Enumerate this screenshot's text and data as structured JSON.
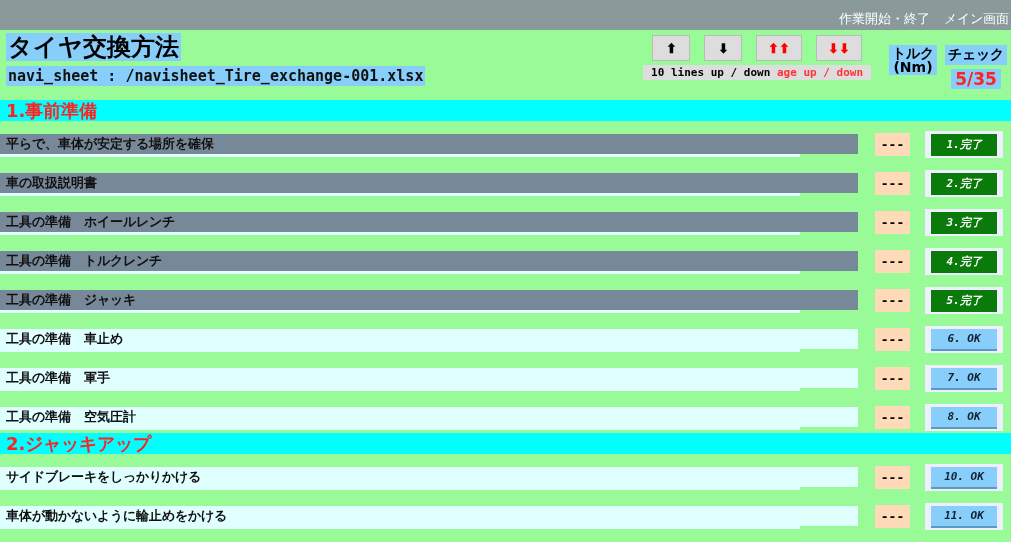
{
  "top_bar": {
    "links": [
      "作業開始・終了",
      "メイン画面"
    ]
  },
  "header": {
    "title": "タイヤ交換方法",
    "file": "navi_sheet : /navisheet_Tire_exchange-001.xlsx",
    "buttons": [
      {
        "label": "⬆",
        "kind": "single"
      },
      {
        "label": "⬇",
        "kind": "single"
      },
      {
        "label": "⬆⬆",
        "kind": "double"
      },
      {
        "label": "⬇⬇",
        "kind": "double"
      }
    ],
    "hint": {
      "plain": "10 lines up / down",
      "accent": "age up / down"
    },
    "torque_heading": "トルク\n(Nm)",
    "check_heading": "チェック",
    "progress": "5/35"
  },
  "sections": [
    {
      "title": "1.事前準備",
      "items": [
        {
          "label": "平らで、車体が安定する場所を確保",
          "torque": "---",
          "check": "1.完了",
          "done": true
        },
        {
          "label": "車の取扱説明書",
          "torque": "---",
          "check": "2.完了",
          "done": true
        },
        {
          "label": "工具の準備　ホイールレンチ",
          "torque": "---",
          "check": "3.完了",
          "done": true
        },
        {
          "label": "工具の準備　トルクレンチ",
          "torque": "---",
          "check": "4.完了",
          "done": true
        },
        {
          "label": "工具の準備　ジャッキ",
          "torque": "---",
          "check": "5.完了",
          "done": true
        },
        {
          "label": "工具の準備　車止め",
          "torque": "---",
          "check": "6. OK",
          "done": false
        },
        {
          "label": "工具の準備　軍手",
          "torque": "---",
          "check": "7. OK",
          "done": false
        },
        {
          "label": "工具の準備　空気圧計",
          "torque": "---",
          "check": "8. OK",
          "done": false
        }
      ]
    },
    {
      "title": "2.ジャッキアップ",
      "items": [
        {
          "label": "サイドブレーキをしっかりかける",
          "torque": "---",
          "check": "10. OK",
          "done": false
        },
        {
          "label": "車体が動かないように輪止めをかける",
          "torque": "---",
          "check": "11. OK",
          "done": false
        }
      ]
    }
  ]
}
